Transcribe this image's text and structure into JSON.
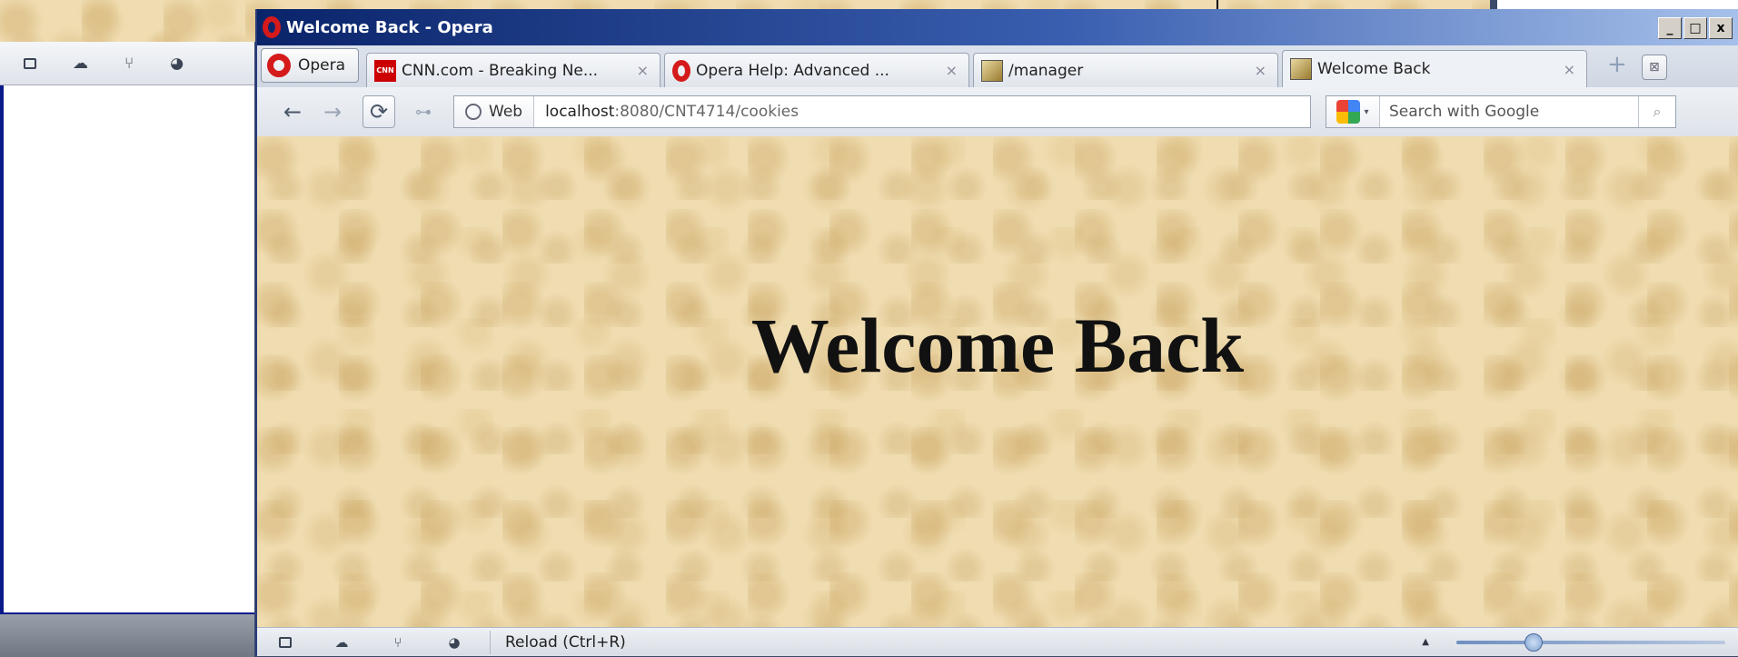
{
  "window": {
    "title": "Welcome Back - Opera",
    "controls": {
      "minimize": "_",
      "maximize": "□",
      "close": "x"
    }
  },
  "tabs": {
    "menu_label": "Opera",
    "items": [
      {
        "title": "CNN.com - Breaking Ne...",
        "favicon": "cnn-favicon",
        "favicon_text": "CNN",
        "close": "×",
        "active": false
      },
      {
        "title": "Opera Help: Advanced ...",
        "favicon": "opera-favicon",
        "close": "×",
        "active": false
      },
      {
        "title": "/manager",
        "favicon": "image-favicon",
        "close": "×",
        "active": false
      },
      {
        "title": "Welcome Back",
        "favicon": "image-favicon",
        "close": "×",
        "active": true
      }
    ],
    "new_tab": "+",
    "trash": "⊠"
  },
  "nav": {
    "back": "←",
    "forward": "→",
    "reload": "⟳",
    "key": "⊶",
    "site_badge": "Web",
    "url_host": "localhost",
    "url_rest": ":8080/CNT4714/cookies"
  },
  "search": {
    "placeholder": "Search with Google",
    "dropdown": "▾",
    "go": "⌕"
  },
  "page": {
    "heading": "Welcome Back"
  },
  "status_bar": {
    "text": "Reload (Ctrl+R)",
    "zoom_arrow": "▲",
    "zoom_level": 0.27
  },
  "icons": {
    "unite": "☁",
    "turbo": "⑂",
    "speed": "◕"
  },
  "colors": {
    "title_bar_start": "#0a246a",
    "opera_red": "#d41a1a",
    "content_background": "#efdcb0"
  }
}
